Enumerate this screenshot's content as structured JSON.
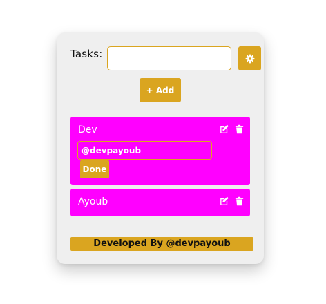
{
  "header": {
    "tasks_label": "Tasks:",
    "input_value": "",
    "input_placeholder": "",
    "settings_icon": "gear-icon"
  },
  "add_button": {
    "label": "+ Add"
  },
  "tasks": [
    {
      "name": "Dev",
      "editing": true,
      "edit_value": "@devpayoub",
      "done_label": "Done",
      "icons": [
        "edit-icon",
        "trash-icon"
      ]
    },
    {
      "name": "Ayoub",
      "editing": false,
      "icons": [
        "edit-icon",
        "trash-icon"
      ]
    }
  ],
  "footer": {
    "text": "Developed By @devpayoub"
  },
  "colors": {
    "accent": "#daa520",
    "task_bg": "#ff00ff",
    "card_bg": "#efefef",
    "page_bg": "#ffffff"
  }
}
